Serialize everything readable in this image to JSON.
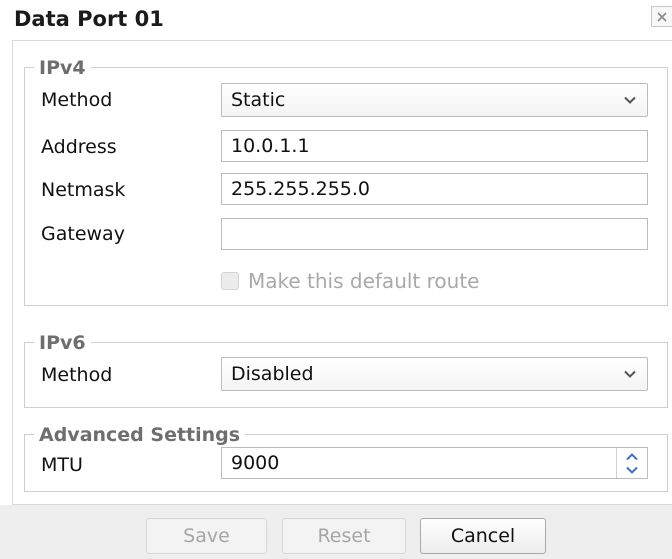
{
  "dialog": {
    "title": "Data Port 01",
    "close_icon": "close-icon"
  },
  "ipv4": {
    "legend": "IPv4",
    "method_label": "Method",
    "method_value": "Static",
    "address_label": "Address",
    "address_value": "10.0.1.1",
    "netmask_label": "Netmask",
    "netmask_value": "255.255.255.0",
    "gateway_label": "Gateway",
    "gateway_value": "",
    "default_route_label": "Make this default route",
    "default_route_checked": false
  },
  "ipv6": {
    "legend": "IPv6",
    "method_label": "Method",
    "method_value": "Disabled"
  },
  "advanced": {
    "legend": "Advanced Settings",
    "mtu_label": "MTU",
    "mtu_value": "9000"
  },
  "footer": {
    "save_label": "Save",
    "reset_label": "Reset",
    "cancel_label": "Cancel"
  },
  "colors": {
    "legend_gray": "#6e6e6e",
    "footer_bg": "#eeeeee",
    "disabled_text": "#a6a6a6"
  }
}
